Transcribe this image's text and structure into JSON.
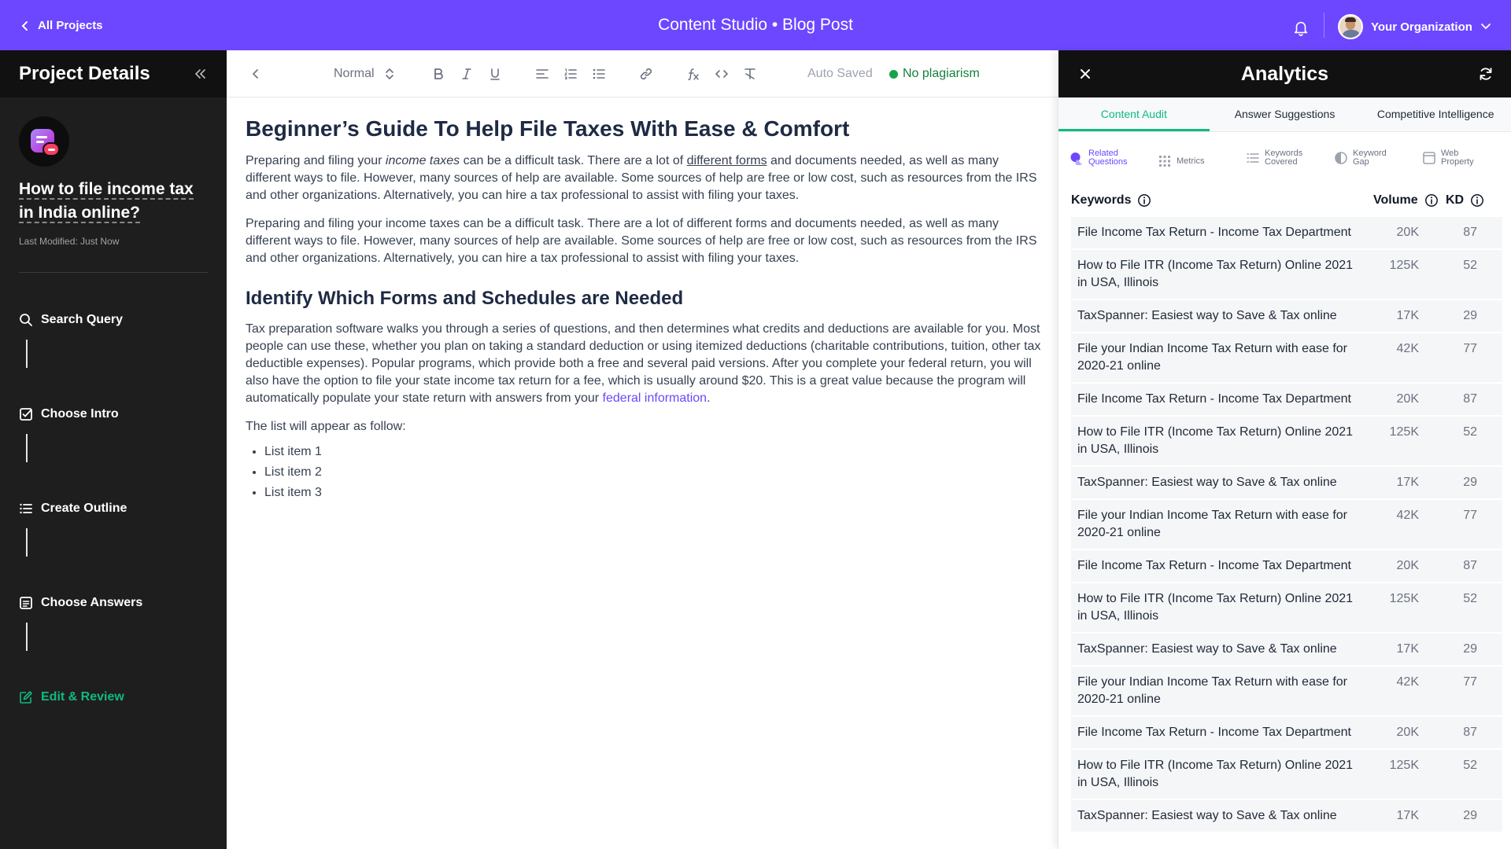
{
  "topbar": {
    "back_label": "All Projects",
    "title": "Content Studio • Blog Post",
    "org_name": "Your Organization",
    "brand_color": "#6c47ff"
  },
  "sidebar": {
    "heading": "Project Details",
    "project_title": "How to file income tax in India online?",
    "last_modified": "Last Modified: Just Now",
    "steps": [
      {
        "label": "Search Query",
        "icon": "search-icon"
      },
      {
        "label": "Choose Intro",
        "icon": "checkbox-icon"
      },
      {
        "label": "Create Outline",
        "icon": "list-icon"
      },
      {
        "label": "Choose Answers",
        "icon": "document-icon"
      },
      {
        "label": "Edit & Review",
        "icon": "edit-icon",
        "active": true
      }
    ]
  },
  "editor": {
    "format_label": "Normal",
    "auto_saved": "Auto Saved",
    "plagiarism_status": "No plagiarism",
    "doc": {
      "title": "Beginner’s Guide To Help File Taxes With Ease & Comfort",
      "p1": {
        "a": "Preparing and filing your ",
        "b": "income taxes",
        "c": " can be a difficult task. There are a lot of ",
        "d": "different forms",
        "e": " and documents needed, as well as many different ways to file. However, many sources of help are available. Some sources of help are free or low cost, such as resources from the IRS and other organizations. Alternatively, you can hire a tax professional to assist with filing your taxes."
      },
      "p2": "Preparing and filing your income taxes can be a difficult task. There are a lot of different forms and documents needed, as well as many different ways to file. However, many sources of help are available. Some sources of help are free or low cost, such as resources from the IRS and other organizations. Alternatively, you can hire a tax professional to assist with filing your taxes.",
      "h2": "Identify Which Forms and Schedules are Needed",
      "p3": {
        "a": "Tax preparation software walks you through a series of questions, and then determines what credits and deductions are available for you. Most people can use these, whether you plan on taking a standard deduction or using itemized deductions (charitable contributions, tuition, other tax deductible expenses). Popular programs, which provide both a free and several paid versions. After you complete your federal return, you will also have the option to file your state income tax return for a fee, which is usually around $20. This is a great value because the program will automatically populate your state return with answers from your ",
        "link": "federal information",
        "end": "."
      },
      "list_intro": "The list will appear as follow:",
      "list_items": [
        "List item 1",
        "List item 2",
        "List item 3"
      ]
    }
  },
  "analytics": {
    "title": "Analytics",
    "tabs": [
      {
        "label": "Content Audit",
        "active": true
      },
      {
        "label": "Answer Suggestions"
      },
      {
        "label": "Competitive Intelligence"
      }
    ],
    "subtabs": [
      {
        "line1": "Related",
        "line2": "Questions",
        "icon": "chat-bubbles-icon",
        "active": true
      },
      {
        "line1": "Metrics",
        "line2": "",
        "icon": "grid-icon"
      },
      {
        "line1": "Keywords",
        "line2": "Covered",
        "icon": "list-icon"
      },
      {
        "line1": "Keyword",
        "line2": "Gap",
        "icon": "toggle-icon"
      },
      {
        "line1": "Web",
        "line2": "Property",
        "icon": "window-icon"
      }
    ],
    "columns": {
      "keyword": "Keywords",
      "volume": "Volume",
      "kd": "KD"
    },
    "rows": [
      {
        "keyword": "File Income Tax Return - Income Tax Department",
        "volume": "20K",
        "kd": "87"
      },
      {
        "keyword": "How to File ITR (Income Tax Return) Online 2021 in USA, Illinois",
        "volume": "125K",
        "kd": "52"
      },
      {
        "keyword": "TaxSpanner: Easiest way to Save & Tax online",
        "volume": "17K",
        "kd": "29"
      },
      {
        "keyword": "File your Indian Income Tax Return with ease for 2020-21 online",
        "volume": "42K",
        "kd": "77"
      },
      {
        "keyword": "File Income Tax Return - Income Tax Department",
        "volume": "20K",
        "kd": "87"
      },
      {
        "keyword": "How to File ITR (Income Tax Return) Online 2021 in USA, Illinois",
        "volume": "125K",
        "kd": "52"
      },
      {
        "keyword": "TaxSpanner: Easiest way to Save & Tax online",
        "volume": "17K",
        "kd": "29"
      },
      {
        "keyword": "File your Indian Income Tax Return with ease for 2020-21 online",
        "volume": "42K",
        "kd": "77"
      },
      {
        "keyword": "File Income Tax Return - Income Tax Department",
        "volume": "20K",
        "kd": "87"
      },
      {
        "keyword": "How to File ITR (Income Tax Return) Online 2021 in USA, Illinois",
        "volume": "125K",
        "kd": "52"
      },
      {
        "keyword": "TaxSpanner: Easiest way to Save & Tax online",
        "volume": "17K",
        "kd": "29"
      },
      {
        "keyword": "File your Indian Income Tax Return with ease for 2020-21 online",
        "volume": "42K",
        "kd": "77"
      },
      {
        "keyword": "File Income Tax Return - Income Tax Department",
        "volume": "20K",
        "kd": "87"
      },
      {
        "keyword": "How to File ITR (Income Tax Return) Online 2021 in USA, Illinois",
        "volume": "125K",
        "kd": "52"
      },
      {
        "keyword": "TaxSpanner: Easiest way to Save & Tax online",
        "volume": "17K",
        "kd": "29"
      }
    ]
  }
}
